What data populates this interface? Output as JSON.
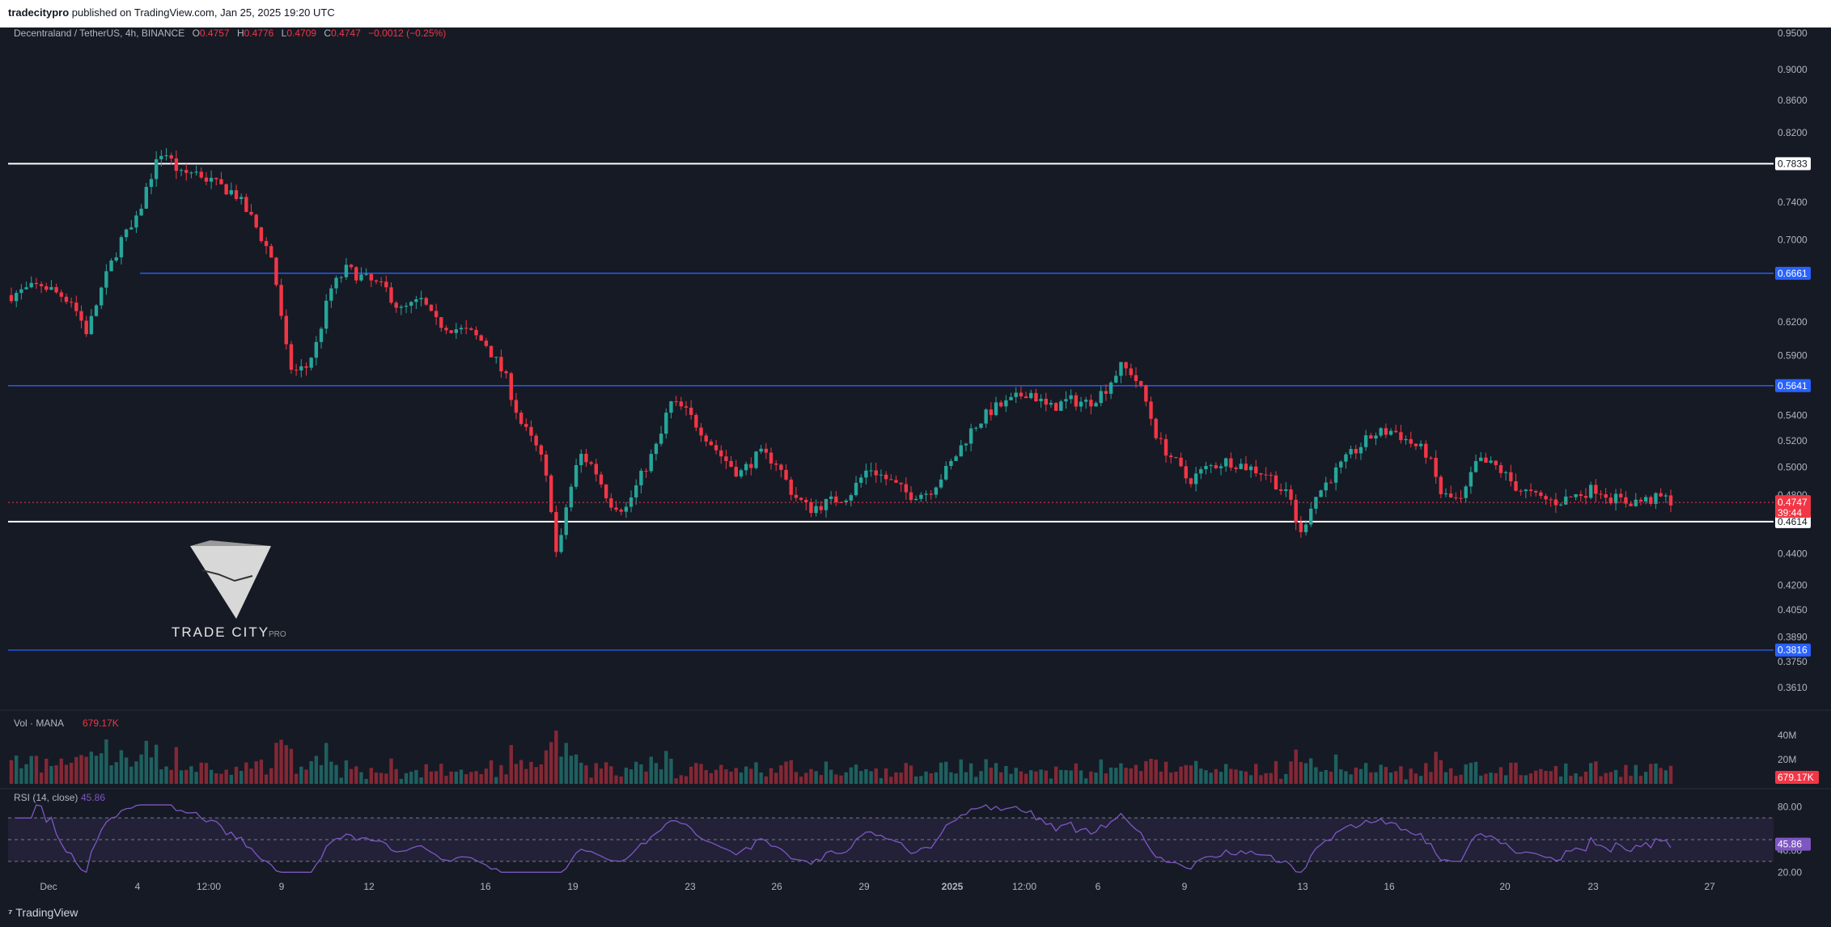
{
  "header": {
    "publisher": "tradecitypro",
    "published_on": "published on TradingView.com, Jan 25, 2025 19:20 UTC"
  },
  "legend": {
    "symbol": "Decentraland / TetherUS, 4h, BINANCE",
    "o_label": "O",
    "o": "0.4757",
    "h_label": "H",
    "h": "0.4776",
    "l_label": "L",
    "l": "0.4709",
    "c_label": "C",
    "c": "0.4747",
    "change": "−0.0012 (−0.25%)"
  },
  "footer": {
    "brand": "TradingView"
  },
  "watermark": {
    "name": "TRADE CITY",
    "suffix": "PRO"
  },
  "colors": {
    "up": "#26a69a",
    "down": "#f23645",
    "background": "#161a25",
    "level_blue": "#2962ff",
    "rsi": "#7e57c2"
  },
  "chart_data": [
    {
      "type": "candlestick",
      "title": "Decentraland / TetherUS, 4h, BINANCE",
      "price_ticks": [
        "0.9500",
        "0.9000",
        "0.8600",
        "0.8200",
        "0.7833",
        "0.7400",
        "0.7000",
        "0.6661",
        "0.6200",
        "0.5900",
        "0.5641",
        "0.5400",
        "0.5200",
        "0.5000",
        "0.4800",
        "0.4747",
        "39:44",
        "0.4614",
        "0.4400",
        "0.4200",
        "0.4050",
        "0.3890",
        "0.3816",
        "0.3750",
        "0.3610"
      ],
      "time_ticks": [
        "Dec",
        "4",
        "12:00",
        "9",
        "12",
        "16",
        "19",
        "23",
        "26",
        "29",
        "2025",
        "12:00",
        "6",
        "9",
        "13",
        "16",
        "20",
        "23",
        "27"
      ],
      "ylim": [
        0.35,
        0.96
      ],
      "log_scale": true,
      "levels": [
        {
          "price": 0.7833,
          "color": "#ffffff",
          "label": "0.7833"
        },
        {
          "price": 0.6661,
          "color": "#2962ff",
          "label": "0.6661"
        },
        {
          "price": 0.5641,
          "color": "#2962ff",
          "label": "0.5641"
        },
        {
          "price": 0.4614,
          "color": "#ffffff",
          "label": "0.4614"
        },
        {
          "price": 0.3816,
          "color": "#2962ff",
          "label": "0.3816"
        }
      ],
      "last_price": {
        "value": "0.4747",
        "countdown": "39:44"
      },
      "path": [
        [
          0,
          0.645
        ],
        [
          15,
          0.655
        ],
        [
          30,
          0.64
        ],
        [
          38,
          0.61
        ],
        [
          45,
          0.65
        ],
        [
          55,
          0.7
        ],
        [
          62,
          0.715
        ],
        [
          70,
          0.77
        ],
        [
          76,
          0.8
        ],
        [
          85,
          0.77
        ],
        [
          92,
          0.775
        ],
        [
          102,
          0.76
        ],
        [
          112,
          0.75
        ],
        [
          121,
          0.72
        ],
        [
          131,
          0.68
        ],
        [
          137,
          0.6
        ],
        [
          141,
          0.575
        ],
        [
          148,
          0.58
        ],
        [
          153,
          0.6
        ],
        [
          160,
          0.65
        ],
        [
          168,
          0.67
        ],
        [
          178,
          0.66
        ],
        [
          188,
          0.65
        ],
        [
          195,
          0.63
        ],
        [
          206,
          0.64
        ],
        [
          212,
          0.62
        ],
        [
          220,
          0.615
        ],
        [
          230,
          0.61
        ],
        [
          238,
          0.6
        ],
        [
          248,
          0.57
        ],
        [
          255,
          0.535
        ],
        [
          265,
          0.51
        ],
        [
          270,
          0.48
        ],
        [
          274,
          0.43
        ],
        [
          277,
          0.465
        ],
        [
          285,
          0.51
        ],
        [
          292,
          0.5
        ],
        [
          300,
          0.475
        ],
        [
          308,
          0.47
        ],
        [
          318,
          0.5
        ],
        [
          325,
          0.52
        ],
        [
          330,
          0.55
        ],
        [
          337,
          0.545
        ],
        [
          345,
          0.53
        ],
        [
          355,
          0.51
        ],
        [
          365,
          0.495
        ],
        [
          375,
          0.51
        ],
        [
          383,
          0.505
        ],
        [
          392,
          0.48
        ],
        [
          400,
          0.47
        ],
        [
          410,
          0.475
        ],
        [
          420,
          0.48
        ],
        [
          430,
          0.5
        ],
        [
          440,
          0.49
        ],
        [
          450,
          0.48
        ],
        [
          460,
          0.482
        ],
        [
          470,
          0.5
        ],
        [
          482,
          0.53
        ],
        [
          492,
          0.545
        ],
        [
          500,
          0.55
        ],
        [
          510,
          0.56
        ],
        [
          520,
          0.545
        ],
        [
          530,
          0.552
        ],
        [
          540,
          0.55
        ],
        [
          548,
          0.56
        ],
        [
          556,
          0.58
        ],
        [
          562,
          0.575
        ],
        [
          568,
          0.555
        ],
        [
          575,
          0.52
        ],
        [
          583,
          0.505
        ],
        [
          590,
          0.49
        ],
        [
          600,
          0.5
        ],
        [
          610,
          0.505
        ],
        [
          620,
          0.5
        ],
        [
          630,
          0.495
        ],
        [
          636,
          0.485
        ],
        [
          642,
          0.475
        ],
        [
          646,
          0.45
        ],
        [
          652,
          0.475
        ],
        [
          660,
          0.49
        ],
        [
          672,
          0.51
        ],
        [
          683,
          0.525
        ],
        [
          693,
          0.528
        ],
        [
          700,
          0.52
        ],
        [
          710,
          0.51
        ],
        [
          717,
          0.48
        ],
        [
          727,
          0.475
        ],
        [
          735,
          0.505
        ],
        [
          745,
          0.5
        ],
        [
          755,
          0.485
        ],
        [
          765,
          0.478
        ],
        [
          775,
          0.475
        ],
        [
          785,
          0.48
        ],
        [
          795,
          0.485
        ],
        [
          802,
          0.478
        ],
        [
          810,
          0.475
        ],
        [
          820,
          0.476
        ],
        [
          828,
          0.478
        ],
        [
          832,
          0.476
        ]
      ]
    },
    {
      "type": "bar",
      "title": "Vol · MANA",
      "last_value": "679.17K",
      "y_ticks": [
        "40M",
        "20M"
      ]
    },
    {
      "type": "line",
      "title": "RSI (14, close)",
      "last_value": "45.86",
      "y_ticks": [
        "80.00",
        "40.00",
        "20.00"
      ]
    }
  ]
}
